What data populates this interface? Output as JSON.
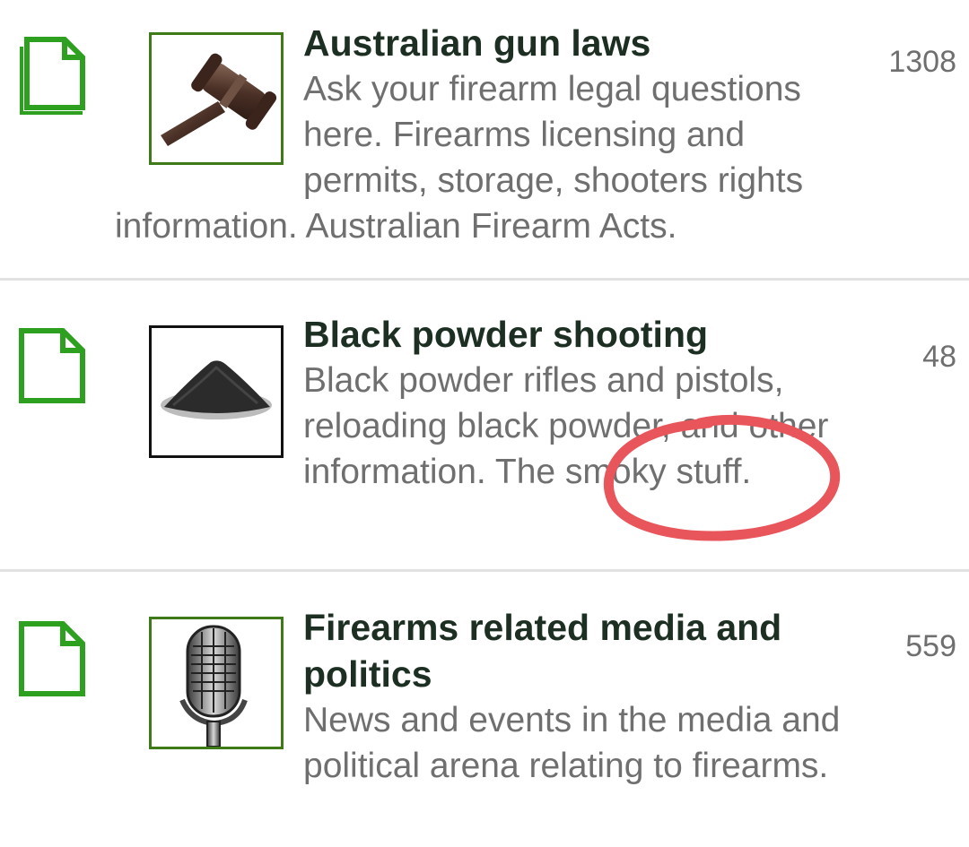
{
  "forums": [
    {
      "title": "Australian gun laws",
      "description": "Ask your firearm legal questions here. Firearms licensing and permits, storage, shooters rights information. Australian Firearm Acts.",
      "count": "1308",
      "status_icon": "document-stack-icon",
      "thumbnail_icon": "gavel-icon"
    },
    {
      "title": "Black powder shooting",
      "description": "Black powder rifles and pistols, reloading black powder, and other information. The smoky stuff.",
      "count": "48",
      "status_icon": "document-icon",
      "thumbnail_icon": "powder-pile-icon"
    },
    {
      "title": "Firearms related media and politics",
      "description": "News and events in the media and political arena relating to firearms.",
      "count": "559",
      "status_icon": "document-icon",
      "thumbnail_icon": "microphone-icon"
    }
  ],
  "colors": {
    "accent_green": "#2da01f",
    "title": "#1c2f22",
    "text_gray": "#6f6f6f",
    "annotation_red": "#e8555a"
  }
}
